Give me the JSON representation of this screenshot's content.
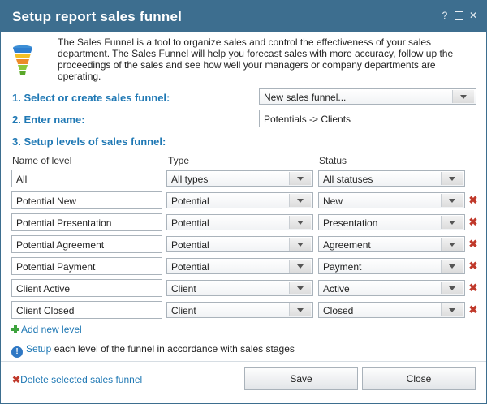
{
  "window": {
    "title": "Setup report sales funnel",
    "help_glyph": "?",
    "maximize_glyph": "",
    "close_glyph": "✕"
  },
  "intro_text": "The Sales Funnel is a tool to organize sales and control the effectiveness of your sales department. The Sales Funnel will help you forecast sales with more accuracy, follow up the proceedings of the sales and see how well your managers or company departments are operating.",
  "step1": {
    "label": "1. Select or create sales funnel:",
    "value": "New sales funnel..."
  },
  "step2": {
    "label": "2. Enter name:",
    "value": "Potentials -> Clients"
  },
  "step3": {
    "label": "3. Setup levels of sales funnel:"
  },
  "columns": {
    "name": "Name of level",
    "type": "Type",
    "status": "Status"
  },
  "levels": [
    {
      "name": "All",
      "type": "All types",
      "status": "All statuses",
      "deletable": false
    },
    {
      "name": "Potential New",
      "type": "Potential",
      "status": "New",
      "deletable": true
    },
    {
      "name": "Potential Presentation",
      "type": "Potential",
      "status": "Presentation",
      "deletable": true
    },
    {
      "name": "Potential Agreement",
      "type": "Potential",
      "status": "Agreement",
      "deletable": true
    },
    {
      "name": "Potential Payment",
      "type": "Potential",
      "status": "Payment",
      "deletable": true
    },
    {
      "name": "Client Active",
      "type": "Client",
      "status": "Active",
      "deletable": true
    },
    {
      "name": "Client Closed",
      "type": "Client",
      "status": "Closed",
      "deletable": true
    }
  ],
  "add_level_label": "Add new level",
  "hint": {
    "link": "Setup",
    "text": " each level of the funnel in accordance with sales stages"
  },
  "delete_funnel_label": "Delete selected sales funnel",
  "buttons": {
    "save": "Save",
    "close": "Close"
  },
  "colors": {
    "titlebar": "#3d6e8f",
    "accent": "#1f78b4",
    "delete": "#c0392b",
    "add": "#3ea33e"
  }
}
